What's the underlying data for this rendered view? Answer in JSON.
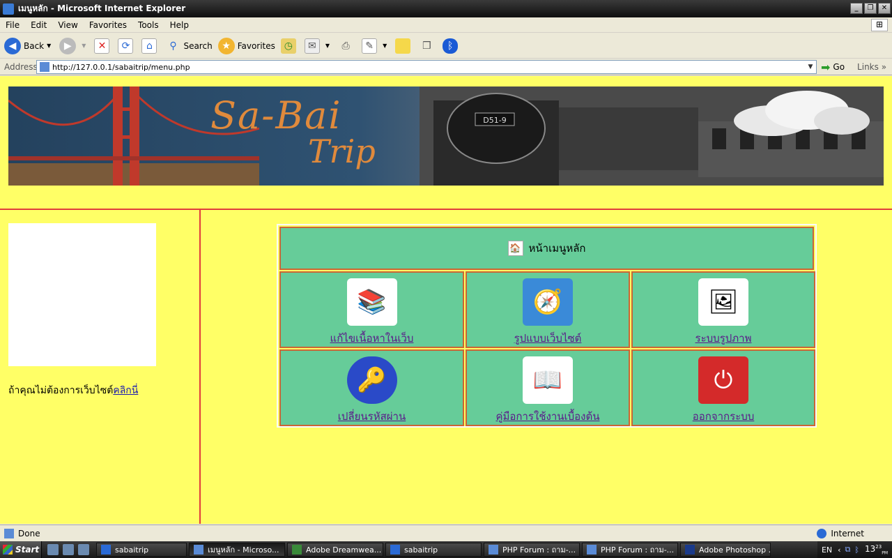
{
  "window": {
    "title": "เมนูหลัก - Microsoft Internet Explorer"
  },
  "menubar": [
    "File",
    "Edit",
    "View",
    "Favorites",
    "Tools",
    "Help"
  ],
  "toolbar": {
    "back": "Back",
    "search": "Search",
    "favorites": "Favorites"
  },
  "address": {
    "label": "Address",
    "url": "http://127.0.0.1/sabaitrip/menu.php",
    "go": "Go",
    "links": "Links"
  },
  "banner": {
    "line1": "Sa-Bai",
    "line2": "Trip",
    "loco_plate": "D51-9"
  },
  "sidebar": {
    "prompt": "ถ้าคุณไม่ต้องการเว็บไซต์",
    "link": "คลิกนี่"
  },
  "menu": {
    "header": "หน้าเมนูหลัก",
    "items": [
      {
        "label": "แก้ไขเนื้อหาในเว็บ",
        "icon": "books-icon"
      },
      {
        "label": "รูปแบบเว็บไซต์",
        "icon": "compass-icon"
      },
      {
        "label": "ระบบรูปภาพ",
        "icon": "picture-icon"
      },
      {
        "label": "เปลี่ยนรหัสผ่าน",
        "icon": "key-icon"
      },
      {
        "label": "คู่มือการใช้งานเบื้องต้น",
        "icon": "manual-icon"
      },
      {
        "label": "ออกจากระบบ",
        "icon": "power-icon"
      }
    ]
  },
  "status": {
    "text": "Done",
    "zone": "Internet"
  },
  "taskbar": {
    "start": "Start",
    "tasks": [
      "sabaitrip",
      "เมนูหลัก - Microso...",
      "Adobe Dreamwea...",
      "sabaitrip",
      "PHP Forum : ถาม-...",
      "PHP Forum : ถาม-...",
      "Adobe Photoshop ..."
    ],
    "lang": "EN",
    "clock": "13",
    "clock_min": "23",
    "clock_ampm": "PM"
  },
  "colors": {
    "page_bg": "#ffff66",
    "cell_bg": "#66cc99",
    "cell_border": "#cc6633",
    "divider": "#e03c3c"
  }
}
